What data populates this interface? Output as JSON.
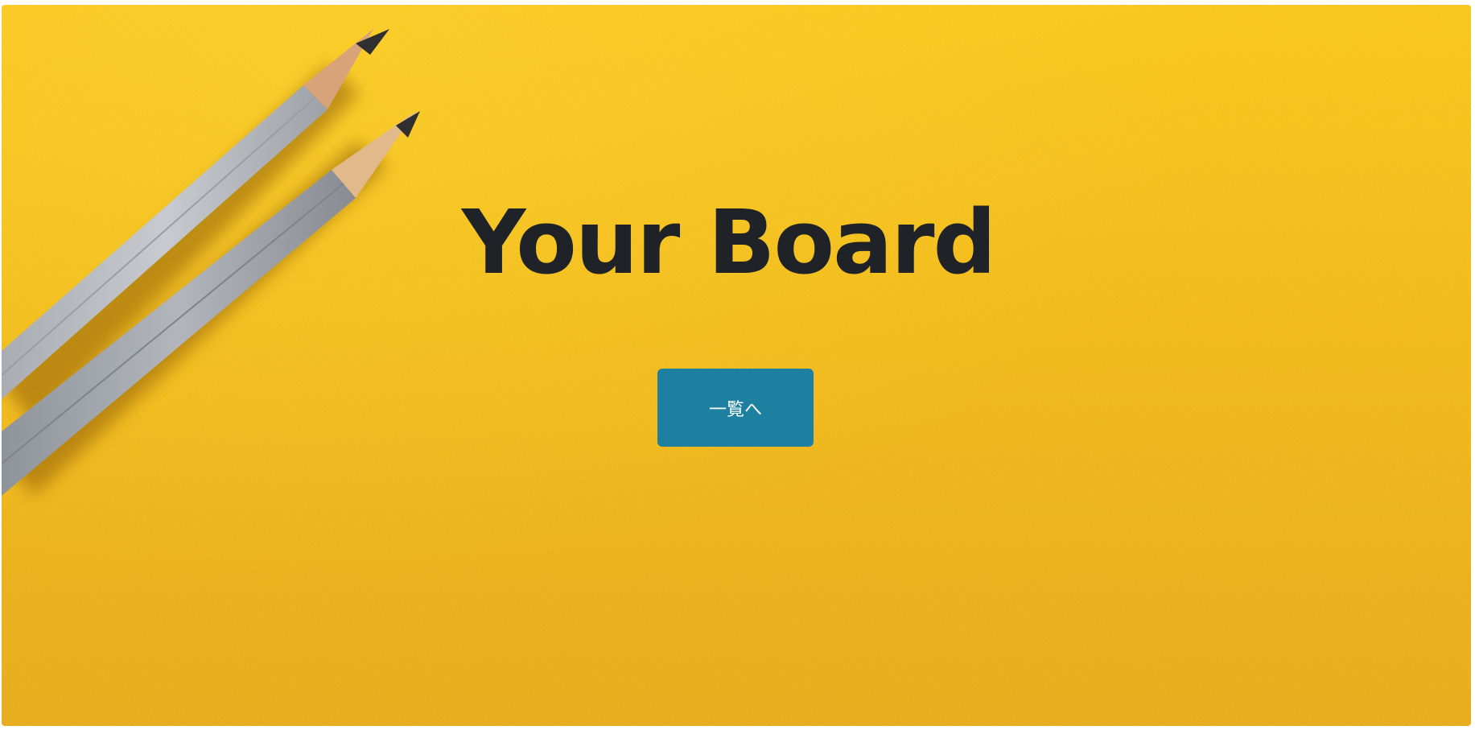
{
  "hero": {
    "title": "Your Board",
    "button_label": "一覧へ",
    "background_color": "#f5bf1e",
    "button_color": "#1d80a0",
    "title_color": "#1f2328",
    "background_image": "two-pencils-on-yellow-paper"
  }
}
